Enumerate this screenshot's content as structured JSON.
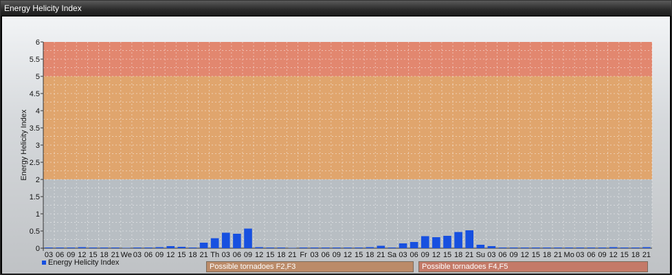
{
  "window": {
    "title": "Energy Helicity Index"
  },
  "colors": {
    "bar": "#1750e0",
    "zone_high": "#e2876f",
    "zone_mid": "#e0a56d",
    "zone_low": "#b8bec3"
  },
  "legend": {
    "label": "Energy Helicity Index"
  },
  "zones": [
    {
      "label": "Possible tornadoes F2,F3",
      "color": "#bb8b69"
    },
    {
      "label": "Possible tornadoes F4,F5",
      "color": "#c47a68"
    }
  ],
  "chart_data": {
    "type": "bar",
    "ylabel": "Energy Helicity Index",
    "ylim": [
      0,
      6
    ],
    "yticks": [
      "0",
      "0.5",
      "1",
      "1.5",
      "2",
      "2.5",
      "3",
      "3.5",
      "4",
      "4.5",
      "5",
      "5.5",
      "6"
    ],
    "grid": true,
    "legend_position": "bottom-left",
    "categories": [
      "03",
      "06",
      "09",
      "12",
      "15",
      "18",
      "21",
      "We",
      "03",
      "06",
      "09",
      "12",
      "15",
      "18",
      "21",
      "Th",
      "03",
      "06",
      "09",
      "12",
      "15",
      "18",
      "21",
      "Fr",
      "03",
      "06",
      "09",
      "12",
      "15",
      "18",
      "21",
      "Sa",
      "03",
      "06",
      "09",
      "12",
      "15",
      "18",
      "21",
      "Su",
      "03",
      "06",
      "09",
      "12",
      "15",
      "18",
      "21",
      "Mo",
      "03",
      "06",
      "09",
      "12",
      "15",
      "18",
      "21"
    ],
    "series": [
      {
        "name": "Energy Helicity Index",
        "values": [
          0.02,
          0.02,
          0.02,
          0.03,
          0.02,
          0.02,
          0.02,
          0.01,
          0.02,
          0.02,
          0.03,
          0.06,
          0.04,
          0.02,
          0.16,
          0.29,
          0.45,
          0.42,
          0.57,
          0.03,
          0.02,
          0.02,
          0.01,
          0.02,
          0.02,
          0.02,
          0.02,
          0.02,
          0.02,
          0.03,
          0.07,
          0.02,
          0.14,
          0.18,
          0.35,
          0.32,
          0.36,
          0.47,
          0.52,
          0.1,
          0.06,
          0.02,
          0.02,
          0.02,
          0.02,
          0.02,
          0.02,
          0.02,
          0.02,
          0.02,
          0.02,
          0.03,
          0.02,
          0.02,
          0.03,
          0.02,
          0.03,
          0.04
        ]
      }
    ],
    "zones": [
      {
        "from": 2,
        "to": 5,
        "label": "Possible tornadoes F2,F3"
      },
      {
        "from": 5,
        "to": 6,
        "label": "Possible tornadoes F4,F5"
      }
    ]
  }
}
